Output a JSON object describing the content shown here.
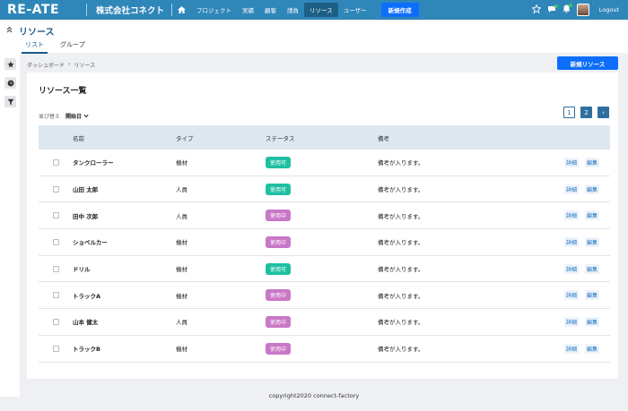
{
  "brand": {
    "logo": "RE-ATE",
    "company": "株式会社コネクト"
  },
  "nav": {
    "items": [
      {
        "label": "プロジェクト",
        "active": false
      },
      {
        "label": "実績",
        "active": false
      },
      {
        "label": "顧客",
        "active": false
      },
      {
        "label": "請負",
        "active": false
      },
      {
        "label": "リソース",
        "active": true
      },
      {
        "label": "ユーザー",
        "active": false
      }
    ],
    "new_label": "新規作成",
    "logout": "Logout"
  },
  "page": {
    "title": "リソース",
    "tabs": [
      {
        "label": "リスト",
        "active": true
      },
      {
        "label": "グループ",
        "active": false
      }
    ],
    "breadcrumb": [
      "ダッシュボード",
      "リソース"
    ],
    "new_resource": "新規リソース"
  },
  "card": {
    "title": "リソース一覧",
    "sort_label": "並び替え",
    "sort_value": "開始日",
    "pages": [
      "1",
      "2"
    ],
    "current_page": "2",
    "next": "›"
  },
  "table": {
    "headers": [
      "名前",
      "タイプ",
      "ステータス",
      "備考"
    ],
    "rows": [
      {
        "name": "タンクローラー",
        "type": "機材",
        "status": "使用可",
        "status_kind": "ok",
        "note": "備考が入ります。",
        "detail": "詳細",
        "edit": "編集"
      },
      {
        "name": "山田 太郎",
        "type": "人員",
        "status": "使用可",
        "status_kind": "ok",
        "note": "備考が入ります。",
        "detail": "詳細",
        "edit": "編集"
      },
      {
        "name": "田中 次郎",
        "type": "人員",
        "status": "使用中",
        "status_kind": "busy",
        "note": "備考が入ります。",
        "detail": "詳細",
        "edit": "編集"
      },
      {
        "name": "ショベルカー",
        "type": "機材",
        "status": "使用中",
        "status_kind": "busy",
        "note": "備考が入ります。",
        "detail": "詳細",
        "edit": "編集"
      },
      {
        "name": "ドリル",
        "type": "機材",
        "status": "使用可",
        "status_kind": "ok",
        "note": "備考が入ります。",
        "detail": "詳細",
        "edit": "編集"
      },
      {
        "name": "トラックA",
        "type": "機材",
        "status": "使用中",
        "status_kind": "busy",
        "note": "備考が入ります。",
        "detail": "詳細",
        "edit": "編集"
      },
      {
        "name": "山本 健太",
        "type": "人員",
        "status": "使用中",
        "status_kind": "busy",
        "note": "備考が入ります。",
        "detail": "詳細",
        "edit": "編集"
      },
      {
        "name": "トラックB",
        "type": "機材",
        "status": "使用中",
        "status_kind": "busy",
        "note": "備考が入ります。",
        "detail": "詳細",
        "edit": "編集"
      }
    ]
  },
  "footer": "copyright2020 connect-factory",
  "colors": {
    "topbar": "#2f86b9",
    "primary": "#0d6efd",
    "status_ok": "#1fbfa3",
    "status_busy": "#c977c6"
  },
  "icons": [
    "home-icon",
    "star-icon",
    "chat-icon",
    "bell-icon",
    "avatar",
    "collapse-icon",
    "favorite-icon",
    "clock-icon",
    "filter-icon",
    "chevron-down-icon",
    "chevron-right-icon"
  ]
}
